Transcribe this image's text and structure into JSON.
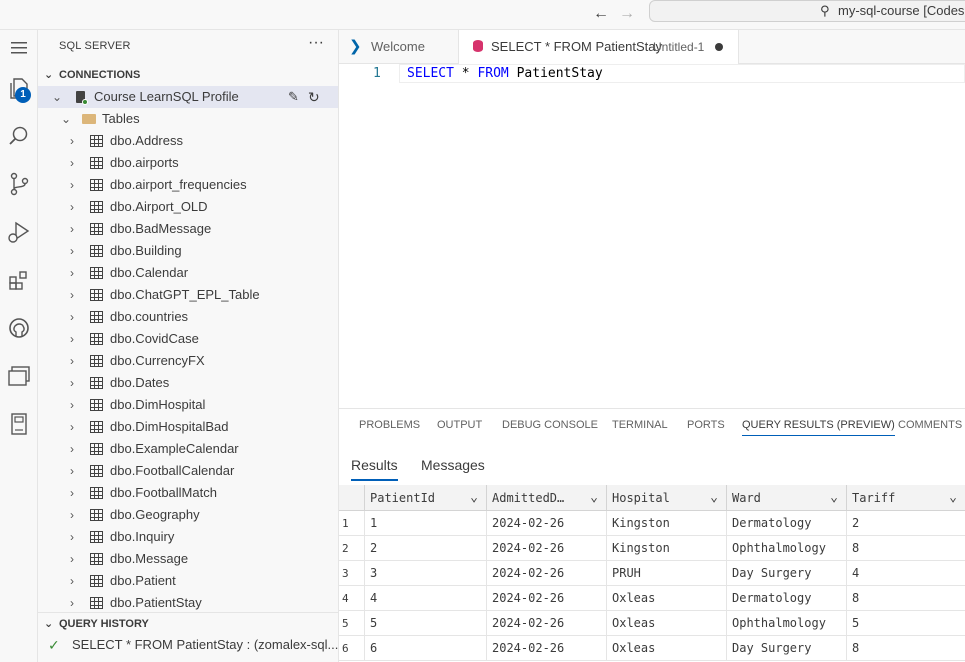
{
  "titlebar": {
    "back_icon": "arrow-left-icon",
    "forward_icon": "arrow-right-icon",
    "command_center": "my-sql-course [Codespaces]"
  },
  "activity": {
    "explorer_badge": "1"
  },
  "sidebar": {
    "title": "SQL SERVER",
    "more": "···",
    "connections_header": "CONNECTIONS",
    "profile_label": "Course LearnSQL Profile",
    "tables_label": "Tables",
    "tables": [
      "dbo.Address",
      "dbo.airports",
      "dbo.airport_frequencies",
      "dbo.Airport_OLD",
      "dbo.BadMessage",
      "dbo.Building",
      "dbo.Calendar",
      "dbo.ChatGPT_EPL_Table",
      "dbo.countries",
      "dbo.CovidCase",
      "dbo.CurrencyFX",
      "dbo.Dates",
      "dbo.DimHospital",
      "dbo.DimHospitalBad",
      "dbo.ExampleCalendar",
      "dbo.FootballCalendar",
      "dbo.FootballMatch",
      "dbo.Geography",
      "dbo.Inquiry",
      "dbo.Message",
      "dbo.Patient",
      "dbo.PatientStay"
    ],
    "query_history_header": "QUERY HISTORY",
    "query_history_item": "SELECT * FROM PatientStay : (zomalex-sql...."
  },
  "tabs": {
    "welcome": "Welcome",
    "query_title": "SELECT * FROM PatientStay",
    "query_desc": "Untitled-1"
  },
  "editor": {
    "line_number": "1",
    "code": {
      "kw1": "SELECT",
      "op": "*",
      "kw2": "FROM",
      "table": "PatientStay"
    }
  },
  "panel": {
    "tabs": [
      "PROBLEMS",
      "OUTPUT",
      "DEBUG CONSOLE",
      "TERMINAL",
      "PORTS",
      "QUERY RESULTS (PREVIEW)",
      "COMMENTS"
    ],
    "active_tab": "QUERY RESULTS (PREVIEW)",
    "results_tab": "Results",
    "messages_tab": "Messages"
  },
  "grid": {
    "columns": [
      "PatientId",
      "AdmittedD…",
      "Hospital",
      "Ward",
      "Tariff"
    ],
    "rows": [
      {
        "n": "1",
        "cells": [
          "1",
          "2024-02-26",
          "Kingston",
          "Dermatology",
          "2"
        ]
      },
      {
        "n": "2",
        "cells": [
          "2",
          "2024-02-26",
          "Kingston",
          "Ophthalmology",
          "8"
        ]
      },
      {
        "n": "3",
        "cells": [
          "3",
          "2024-02-26",
          "PRUH",
          "Day Surgery",
          "4"
        ]
      },
      {
        "n": "4",
        "cells": [
          "4",
          "2024-02-26",
          "Oxleas",
          "Dermatology",
          "8"
        ]
      },
      {
        "n": "5",
        "cells": [
          "5",
          "2024-02-26",
          "Oxleas",
          "Ophthalmology",
          "5"
        ]
      },
      {
        "n": "6",
        "cells": [
          "6",
          "2024-02-26",
          "Oxleas",
          "Day Surgery",
          "8"
        ]
      }
    ]
  },
  "colors": {
    "accent": "#005fb8",
    "keyword": "#0000ff",
    "line_number": "#237893",
    "success": "#388a34"
  }
}
